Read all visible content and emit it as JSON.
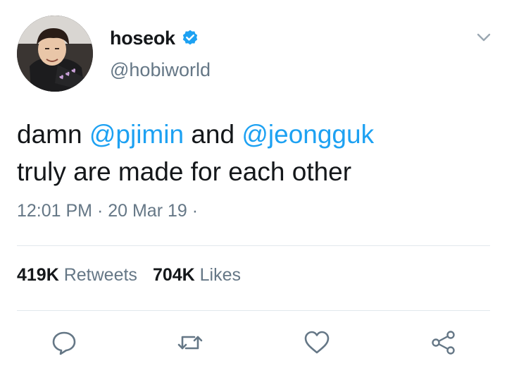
{
  "user": {
    "display_name": "hoseok",
    "handle": "@hobiworld",
    "verified": true
  },
  "tweet": {
    "line1": {
      "word1": "damn ",
      "mention1": "@pjimin",
      "word2": " and ",
      "mention2": "@jeongguk"
    },
    "line2": "truly are made for each other",
    "meta": "12:01 PM · 20 Mar 19 ·"
  },
  "stats": {
    "retweets_count": "419K",
    "retweets_label": "Retweets",
    "likes_count": "704K",
    "likes_label": "Likes"
  },
  "icons": {
    "reply": "reply-icon",
    "retweet": "retweet-icon",
    "like": "heart-icon",
    "share": "share-icon",
    "menu": "chevron-down-icon",
    "verified": "verified-badge-icon"
  },
  "colors": {
    "accent": "#1da1f2",
    "secondary_text": "#657786",
    "primary_text": "#14171a",
    "divider": "#e1e8ed"
  }
}
